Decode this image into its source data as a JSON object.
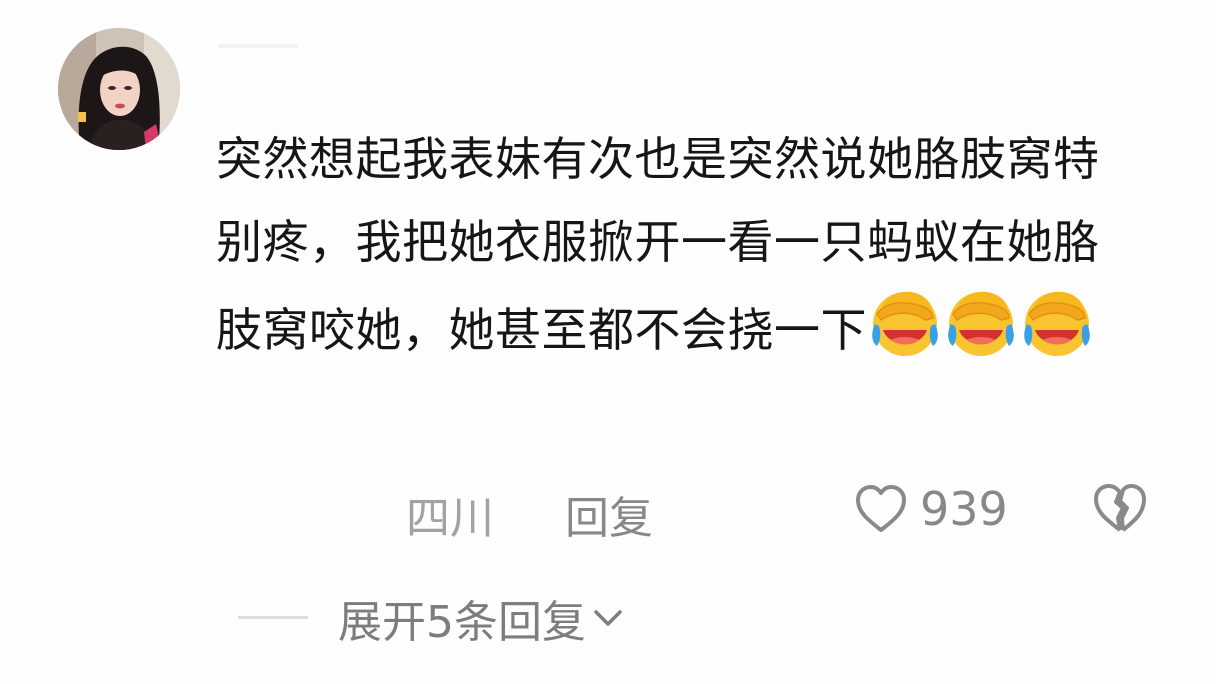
{
  "comment": {
    "text": "突然想起我表妹有次也是突然说她胳肢窝特别疼，我把她衣服掀开一看一只蚂蚁在她胳肢窝咬她，她甚至都不会挠一下",
    "emojis": [
      "facepalm-laughing-emoji",
      "facepalm-laughing-emoji",
      "facepalm-laughing-emoji"
    ]
  },
  "meta": {
    "location": "四川",
    "reply_label": "回复",
    "like_count": "939"
  },
  "replies": {
    "expand_label": "展开5条回复"
  },
  "icons": {
    "like": "heart-outline-icon",
    "dislike": "broken-heart-icon",
    "expand": "chevron-down-icon"
  },
  "colors": {
    "text": "#161616",
    "muted": "#888888",
    "emoji_yellow": "#f8c531",
    "emoji_blue": "#3aa0e6"
  }
}
